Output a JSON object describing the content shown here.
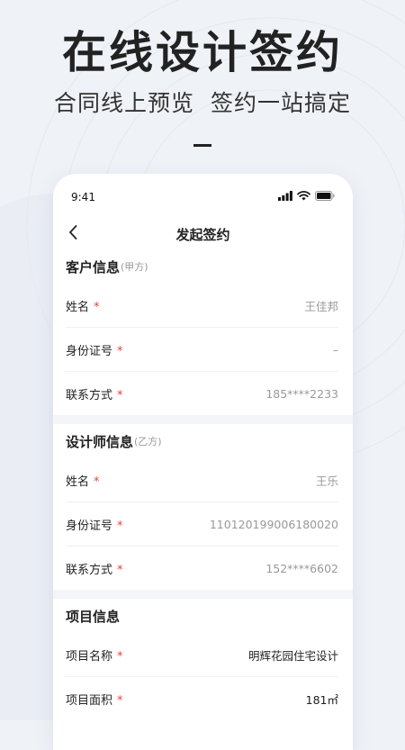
{
  "hero": {
    "title": "在线设计签约",
    "subtitle": "合同线上预览  签约一站搞定"
  },
  "phone": {
    "status_bar": {
      "time": "9:41"
    },
    "nav": {
      "title": "发起签约"
    },
    "required_mark": "*",
    "customer": {
      "title": "客户信息",
      "subtitle": "(甲方)",
      "rows": [
        {
          "label": "姓名",
          "value": "王佳邦"
        },
        {
          "label": "身份证号",
          "value": "–"
        },
        {
          "label": "联系方式",
          "value": "185****2233"
        }
      ]
    },
    "designer": {
      "title": "设计师信息",
      "subtitle": "(乙方)",
      "rows": [
        {
          "label": "姓名",
          "value": "王乐"
        },
        {
          "label": "身份证号",
          "value": "110120199006180020"
        },
        {
          "label": "联系方式",
          "value": "152****6602"
        }
      ]
    },
    "project": {
      "title": "项目信息",
      "rows": [
        {
          "label": "项目名称",
          "value": "明辉花园住宅设计"
        },
        {
          "label": "项目面积",
          "value": "181㎡"
        }
      ]
    }
  },
  "colors": {
    "background": "#eff2f7",
    "required": "#e5433e",
    "muted_text": "#999999"
  }
}
